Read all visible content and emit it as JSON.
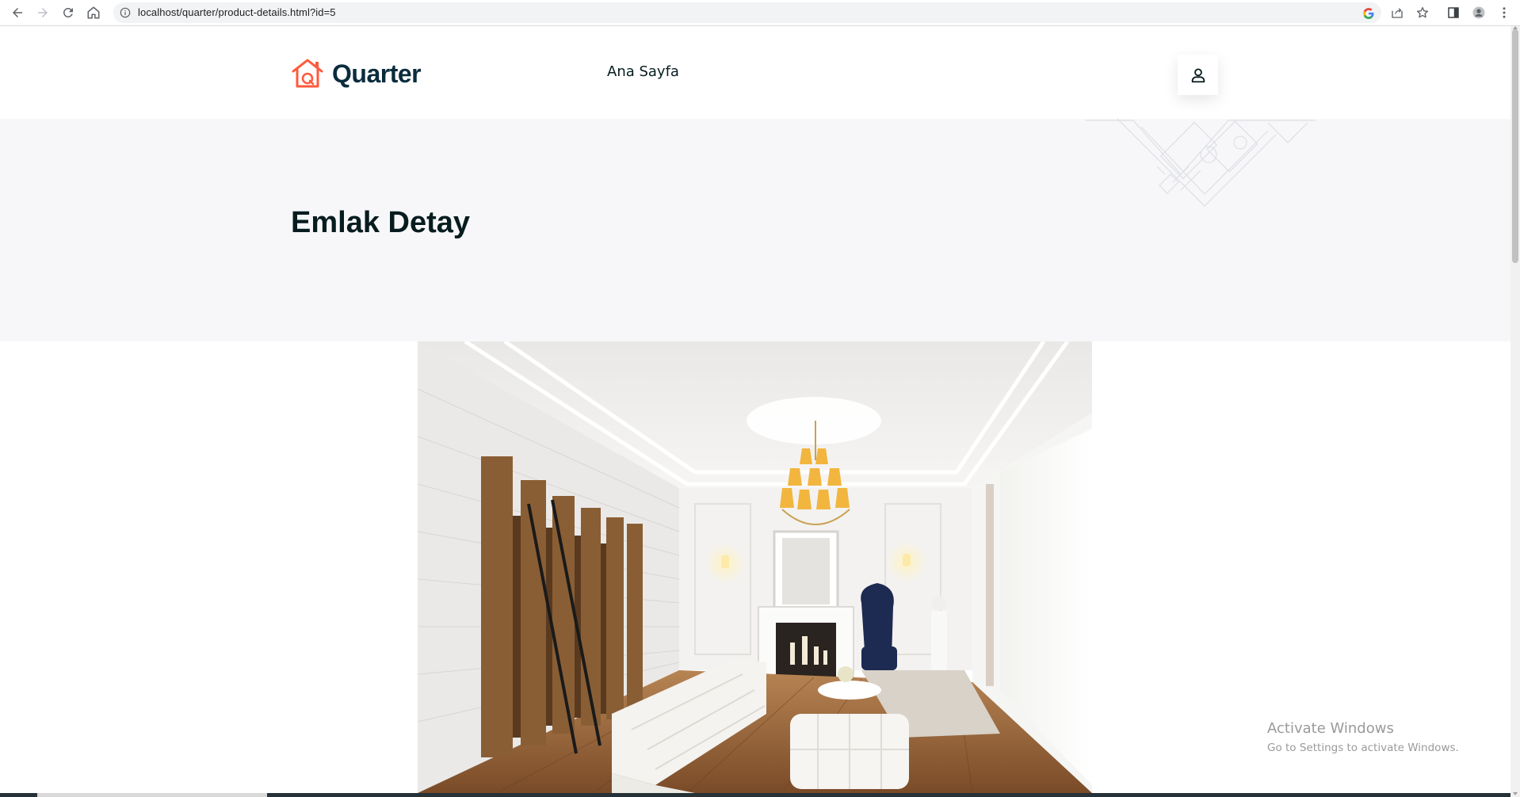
{
  "browser": {
    "url": "localhost/quarter/product-details.html?id=5"
  },
  "header": {
    "logo_text": "Quarter",
    "nav_home": "Ana Sayfa"
  },
  "hero": {
    "title": "Emlak Detay"
  },
  "watermark": {
    "title": "Activate Windows",
    "subtitle": "Go to Settings to activate Windows."
  },
  "colors": {
    "brand_accent": "#ff5a3c",
    "heading": "#071c1f",
    "hero_bg": "#f7f7f9"
  },
  "icons": [
    "back-icon",
    "forward-icon",
    "reload-icon",
    "home-icon",
    "info-icon",
    "google-icon",
    "share-icon",
    "star-icon",
    "side-panel-icon",
    "profile-icon",
    "menu-icon",
    "house-logo-icon",
    "user-icon"
  ]
}
